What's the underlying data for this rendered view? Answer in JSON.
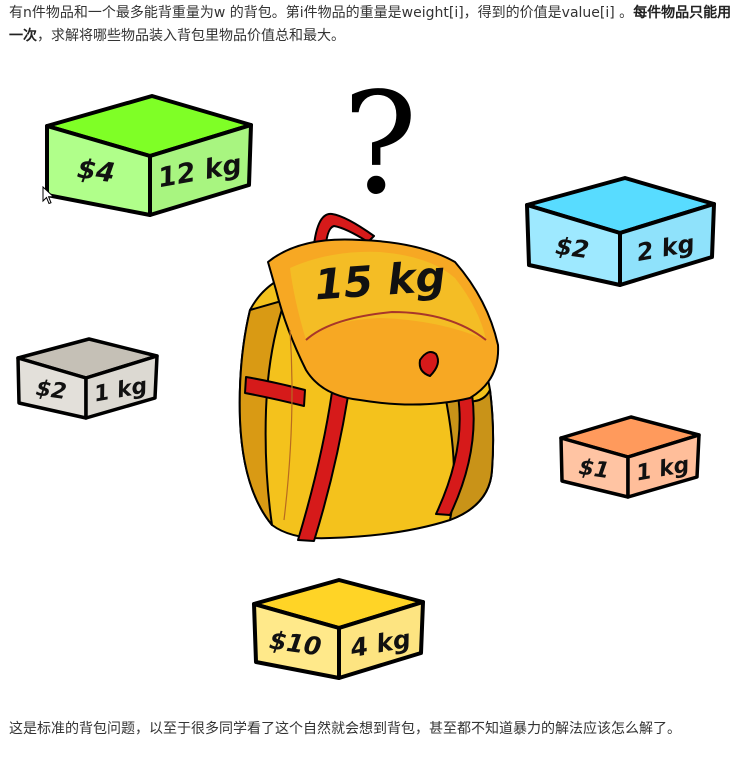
{
  "intro": {
    "part1": "有n件物品和一个最多能背重量为w 的背包。第i件物品的重量是weight[i]，得到的价值是value[i] 。",
    "bold": "每件物品只能用一次",
    "part2": "，求解将哪些物品装入背包里物品价值总和最大。"
  },
  "illustration": {
    "question_mark": "?",
    "bag_label": "15 kg",
    "items": [
      {
        "price": "$4",
        "weight": "12 kg",
        "front": "#b0ff8a",
        "top": "#7fff26",
        "side": "#a8f580"
      },
      {
        "price": "$2",
        "weight": "2 kg",
        "front": "#9ee9ff",
        "top": "#58dcff",
        "side": "#8fe2fb"
      },
      {
        "price": "$2",
        "weight": "1 kg",
        "front": "#e3e0da",
        "top": "#c5c0b6",
        "side": "#dcd9d2"
      },
      {
        "price": "$1",
        "weight": "1 kg",
        "front": "#ffc4a3",
        "top": "#ff9a5c",
        "side": "#ffbe9a"
      },
      {
        "price": "$10",
        "weight": "4 kg",
        "front": "#ffe98a",
        "top": "#ffd426",
        "side": "#fde481"
      }
    ]
  },
  "footer": {
    "text": "这是标准的背包问题，以至于很多同学看了这个自然就会想到背包，甚至都不知道暴力的解法应该怎么解了。"
  }
}
